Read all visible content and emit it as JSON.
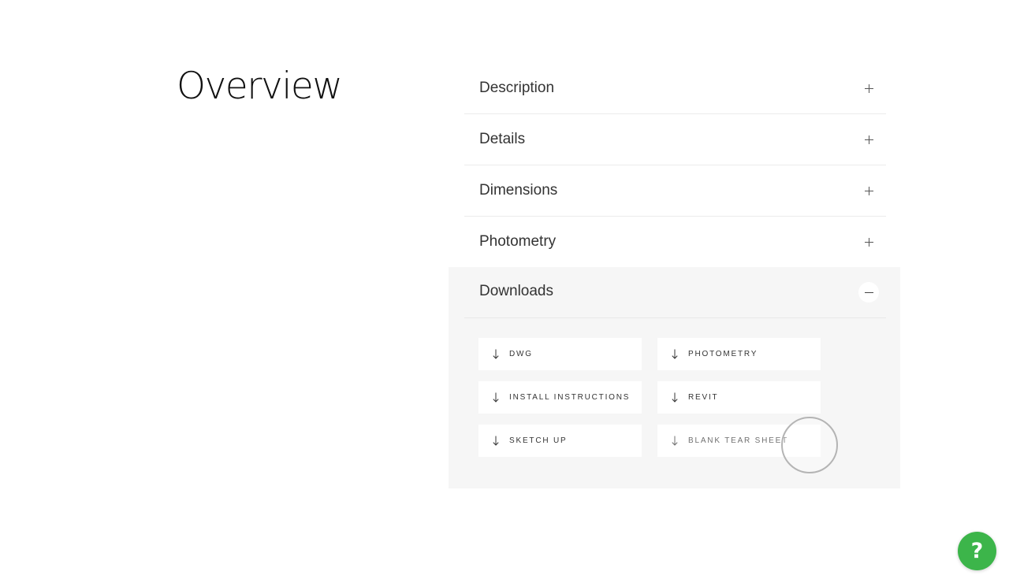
{
  "overview": {
    "title": "Overview"
  },
  "accordion": {
    "items": [
      {
        "label": "Description",
        "toggle": "plus-icon",
        "expanded": false
      },
      {
        "label": "Details",
        "toggle": "plus-icon",
        "expanded": false
      },
      {
        "label": "Dimensions",
        "toggle": "plus-icon",
        "expanded": false
      },
      {
        "label": "Photometry",
        "toggle": "plus-icon",
        "expanded": false
      }
    ],
    "downloads": {
      "label": "Downloads",
      "toggle": "minus-icon",
      "expanded": true,
      "buttons": [
        {
          "label": "DWG",
          "icon": "download-arrow-icon"
        },
        {
          "label": "PHOTOMETRY",
          "icon": "download-arrow-icon"
        },
        {
          "label": "INSTALL INSTRUCTIONS",
          "icon": "download-arrow-icon"
        },
        {
          "label": "REVIT",
          "icon": "download-arrow-icon"
        },
        {
          "label": "SKETCH UP",
          "icon": "download-arrow-icon"
        },
        {
          "label": "BLANK TEAR SHEET",
          "icon": "download-arrow-icon"
        }
      ]
    }
  },
  "help": {
    "glyph": "?",
    "icon": "help-icon",
    "color": "#3cb54a"
  },
  "colors": {
    "panel_background": "#f6f6f6",
    "divider": "#ececec",
    "text": "#333333"
  }
}
